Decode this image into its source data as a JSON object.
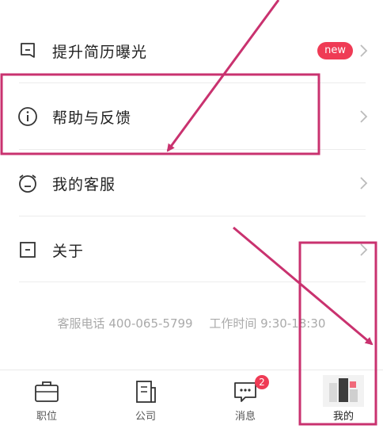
{
  "menu": {
    "items": [
      {
        "label": "提升简历曝光",
        "icon": "bookmark-icon",
        "badge": "new"
      },
      {
        "label": "帮助与反馈",
        "icon": "info-circle-icon"
      },
      {
        "label": "我的客服",
        "icon": "alarm-clock-icon"
      },
      {
        "label": "关于",
        "icon": "about-square-icon"
      }
    ]
  },
  "contact": {
    "phone": "客服电话 400-065-5799",
    "hours": "工作时间 9:30-18:30"
  },
  "tabbar": {
    "tabs": [
      {
        "label": "职位",
        "icon": "briefcase-icon"
      },
      {
        "label": "公司",
        "icon": "building-icon"
      },
      {
        "label": "消息",
        "icon": "chat-icon",
        "count": "2"
      },
      {
        "label": "",
        "icon": "avatar-icon"
      },
      {
        "label": "我的",
        "icon": "profile-icon",
        "active": true
      }
    ]
  },
  "colors": {
    "accent": "#ef3b55",
    "annotation": "#c9326f"
  }
}
